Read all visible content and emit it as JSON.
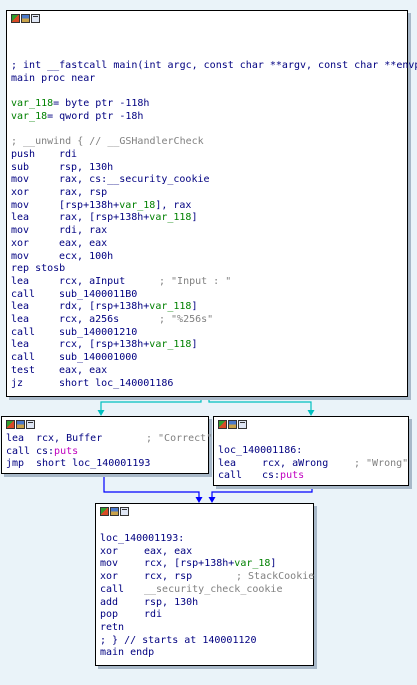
{
  "colors": {
    "background": "#eaf3f9",
    "instruction": "#000080",
    "comment": "#808080",
    "variable": "#008000",
    "import": "#c000c0",
    "edge_true": "#00c0c0",
    "edge_false": "#0000ff"
  },
  "icons": [
    "graph-color-icon",
    "graph-palette-icon",
    "graph-zoom-icon"
  ],
  "block_main": {
    "header_comment": "; int __fastcall main(int argc, const char **argv, const char **envp)",
    "proc": "main proc near",
    "var_118_name": "var_118",
    "var_118_def": "= byte ptr -118h",
    "var_18_name": "var_18",
    "var_18_def": "= qword ptr -18h",
    "unwind": "; __unwind { // __GSHandlerCheck",
    "instructions": [
      {
        "mn": "push",
        "op1": "rdi",
        "op2": "",
        "var": "",
        "tail": "",
        "comment": ""
      },
      {
        "mn": "sub",
        "op1": "rsp, 130h",
        "op2": "",
        "var": "",
        "tail": "",
        "comment": ""
      },
      {
        "mn": "mov",
        "op1": "rax, cs:__security_cookie",
        "op2": "",
        "var": "",
        "tail": "",
        "comment": ""
      },
      {
        "mn": "xor",
        "op1": "rax, rsp",
        "op2": "",
        "var": "",
        "tail": "",
        "comment": ""
      },
      {
        "mn": "mov",
        "op1": "[rsp+138h+",
        "op2": "",
        "var": "var_18",
        "tail": "], rax",
        "comment": ""
      },
      {
        "mn": "lea",
        "op1": "rax, [rsp+138h+",
        "op2": "",
        "var": "var_118",
        "tail": "]",
        "comment": ""
      },
      {
        "mn": "mov",
        "op1": "rdi, rax",
        "op2": "",
        "var": "",
        "tail": "",
        "comment": ""
      },
      {
        "mn": "xor",
        "op1": "eax, eax",
        "op2": "",
        "var": "",
        "tail": "",
        "comment": ""
      },
      {
        "mn": "mov",
        "op1": "ecx, 100h",
        "op2": "",
        "var": "",
        "tail": "",
        "comment": ""
      },
      {
        "mn": "rep stosb",
        "op1": "",
        "op2": "",
        "var": "",
        "tail": "",
        "comment": ""
      },
      {
        "mn": "lea",
        "op1": "rcx, aInput",
        "op2": "",
        "var": "",
        "tail": "",
        "comment": "; \"Input : \""
      },
      {
        "mn": "call",
        "op1": "sub_1400011B0",
        "op2": "",
        "var": "",
        "tail": "",
        "comment": ""
      },
      {
        "mn": "lea",
        "op1": "rdx, [rsp+138h+",
        "op2": "",
        "var": "var_118",
        "tail": "]",
        "comment": ""
      },
      {
        "mn": "lea",
        "op1": "rcx, a256s",
        "op2": "",
        "var": "",
        "tail": "",
        "comment": "; \"%256s\""
      },
      {
        "mn": "call",
        "op1": "sub_140001210",
        "op2": "",
        "var": "",
        "tail": "",
        "comment": ""
      },
      {
        "mn": "lea",
        "op1": "rcx, [rsp+138h+",
        "op2": "",
        "var": "var_118",
        "tail": "]",
        "comment": ""
      },
      {
        "mn": "call",
        "op1": "sub_140001000",
        "op2": "",
        "var": "",
        "tail": "",
        "comment": ""
      },
      {
        "mn": "test",
        "op1": "eax, eax",
        "op2": "",
        "var": "",
        "tail": "",
        "comment": ""
      },
      {
        "mn": "jz",
        "op1": "short loc_140001186",
        "op2": "",
        "var": "",
        "tail": "",
        "comment": ""
      }
    ]
  },
  "block_correct": {
    "instructions": [
      {
        "mn": "lea",
        "op1": "rcx, Buffer",
        "imp": "",
        "comment": "; \"Correct\""
      },
      {
        "mn": "call",
        "op1": "cs:",
        "imp": "puts",
        "comment": ""
      },
      {
        "mn": "jmp",
        "op1": "short loc_140001193",
        "imp": "",
        "comment": ""
      }
    ]
  },
  "block_wrong": {
    "label": "loc_140001186:",
    "instructions": [
      {
        "mn": "lea",
        "op1": "rcx, aWrong",
        "imp": "",
        "comment": "; \"Wrong\""
      },
      {
        "mn": "call",
        "op1": "cs:",
        "imp": "puts",
        "comment": ""
      }
    ]
  },
  "block_end": {
    "label": "loc_140001193:",
    "instructions": [
      {
        "mn": "xor",
        "op1": "eax, eax",
        "var": "",
        "tail": "",
        "gray": "",
        "comment": ""
      },
      {
        "mn": "mov",
        "op1": "rcx, [rsp+138h+",
        "var": "var_18",
        "tail": "]",
        "gray": "",
        "comment": ""
      },
      {
        "mn": "xor",
        "op1": "rcx, rsp",
        "var": "",
        "tail": "",
        "gray": "",
        "comment": "; StackCookie"
      },
      {
        "mn": "call",
        "op1": "",
        "var": "",
        "tail": "",
        "gray": "__security_check_cookie",
        "comment": ""
      },
      {
        "mn": "add",
        "op1": "rsp, 130h",
        "var": "",
        "tail": "",
        "gray": "",
        "comment": ""
      },
      {
        "mn": "pop",
        "op1": "rdi",
        "var": "",
        "tail": "",
        "gray": "",
        "comment": ""
      },
      {
        "mn": "retn",
        "op1": "",
        "var": "",
        "tail": "",
        "gray": "",
        "comment": ""
      }
    ],
    "footer_comment": "; } // starts at 140001120",
    "endp": "main endp"
  }
}
